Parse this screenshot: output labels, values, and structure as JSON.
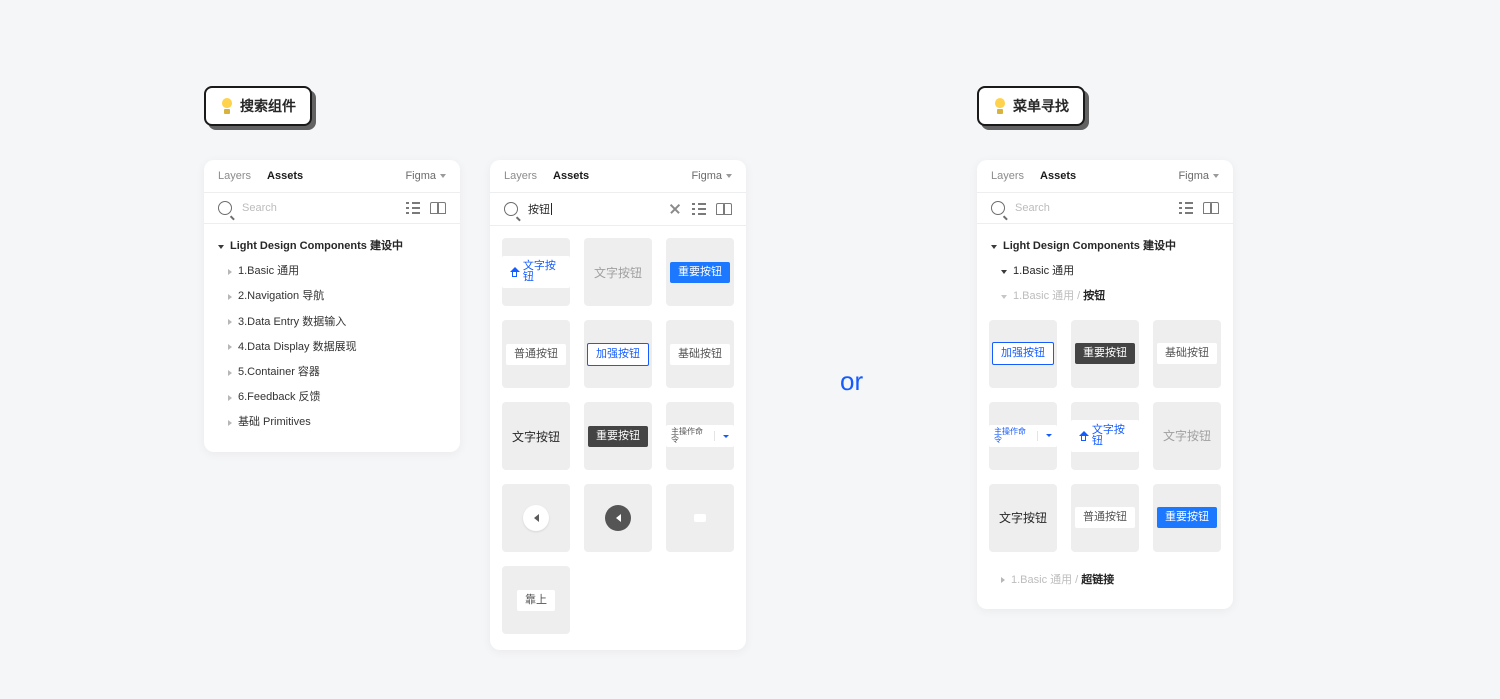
{
  "callouts": {
    "search_label": "搜索组件",
    "menu_label": "菜单寻找"
  },
  "separator": "or",
  "panel1": {
    "tabs": {
      "layers": "Layers",
      "assets": "Assets"
    },
    "team": "Figma",
    "search_placeholder": "Search",
    "tree": {
      "root": "Light Design Components 建设中",
      "children": [
        "1.Basic 通用",
        "2.Navigation 导航",
        "3.Data Entry 数据输入",
        "4.Data Display 数据展现",
        "5.Container 容器",
        "6.Feedback 反馈",
        "基础 Primitives"
      ]
    }
  },
  "panel2": {
    "tabs": {
      "layers": "Layers",
      "assets": "Assets"
    },
    "team": "Figma",
    "search_value": "按钮",
    "tiles": {
      "t0": "文字按钮",
      "t1": "文字按钮",
      "t2": "重要按钮",
      "t3": "普通按钮",
      "t4": "加强按钮",
      "t5": "基础按钮",
      "t6": "文字按钮",
      "t7": "重要按钮",
      "t8": "主操作命令",
      "t12": "靠上"
    }
  },
  "panel3": {
    "tabs": {
      "layers": "Layers",
      "assets": "Assets"
    },
    "team": "Figma",
    "search_placeholder": "Search",
    "root": "Light Design Components 建设中",
    "group_open": "1.Basic 通用",
    "crumb_muted": "1.Basic 通用 / ",
    "crumb_bold": "按钮",
    "tiles": {
      "t0": "加强按钮",
      "t1": "重要按钮",
      "t2": "基础按钮",
      "t3": "主操作命令",
      "t4": "文字按钮",
      "t5": "文字按钮",
      "t6": "文字按钮",
      "t7": "普通按钮",
      "t8": "重要按钮"
    },
    "crumb2_muted": "1.Basic 通用 / ",
    "crumb2_bold": "超链接"
  }
}
